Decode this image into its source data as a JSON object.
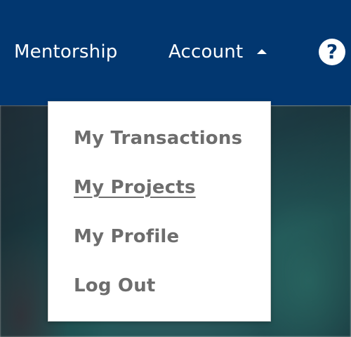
{
  "nav": {
    "items": [
      {
        "label": "Mentorship"
      },
      {
        "label": "Account"
      }
    ],
    "account_caret_icon": "caret-up-icon",
    "help_icon": "question-mark-icon",
    "help_glyph": "?"
  },
  "dropdown": {
    "items": [
      {
        "label": "My Transactions"
      },
      {
        "label": "My Projects",
        "state": "hovered"
      },
      {
        "label": "My Profile"
      },
      {
        "label": "Log Out"
      }
    ]
  },
  "colors": {
    "navbar": "#023770",
    "menu_text": "#6d6d6d",
    "dropdown_bg": "#ffffff"
  }
}
